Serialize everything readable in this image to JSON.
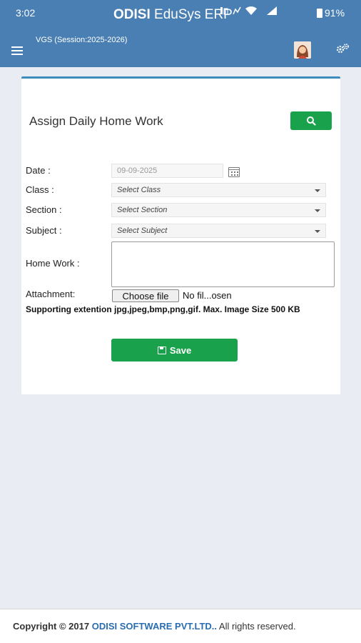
{
  "status_bar": {
    "time": "3:02",
    "battery": "91%"
  },
  "app": {
    "brand": "ODISI",
    "name": "EduSys ERP",
    "session": "VGS (Session:2025-2026)"
  },
  "icons": {
    "menu": "hamburger-icon",
    "profile": "avatar",
    "settings": "gears-icon",
    "search": "search-icon",
    "calendar": "calendar-icon",
    "save": "floppy-disk-icon"
  },
  "colors": {
    "header": "#4a7fb3",
    "button_green": "#1aa14b",
    "card_border": "#3c8dbc"
  },
  "form": {
    "title": "Assign Daily Home Work",
    "date_label": "Date :",
    "date_value": "09-09-2025",
    "class_label": "Class :",
    "class_value": "Select Class",
    "section_label": "Section :",
    "section_value": "Select Section",
    "subject_label": "Subject :",
    "subject_value": "Select Subject",
    "homework_label": "Home Work :",
    "homework_value": "",
    "attachment_label": "Attachment:",
    "file_button": "Choose file",
    "file_name": "No fil...osen",
    "support_text": "Supporting extention jpg,jpeg,bmp,png,gif. Max. Image Size 500 KB",
    "save_label": "Save"
  },
  "footer": {
    "prefix": "Copyright © 2017",
    "company": "ODISI SOFTWARE PVT.LTD..",
    "suffix": "All rights reserved."
  }
}
